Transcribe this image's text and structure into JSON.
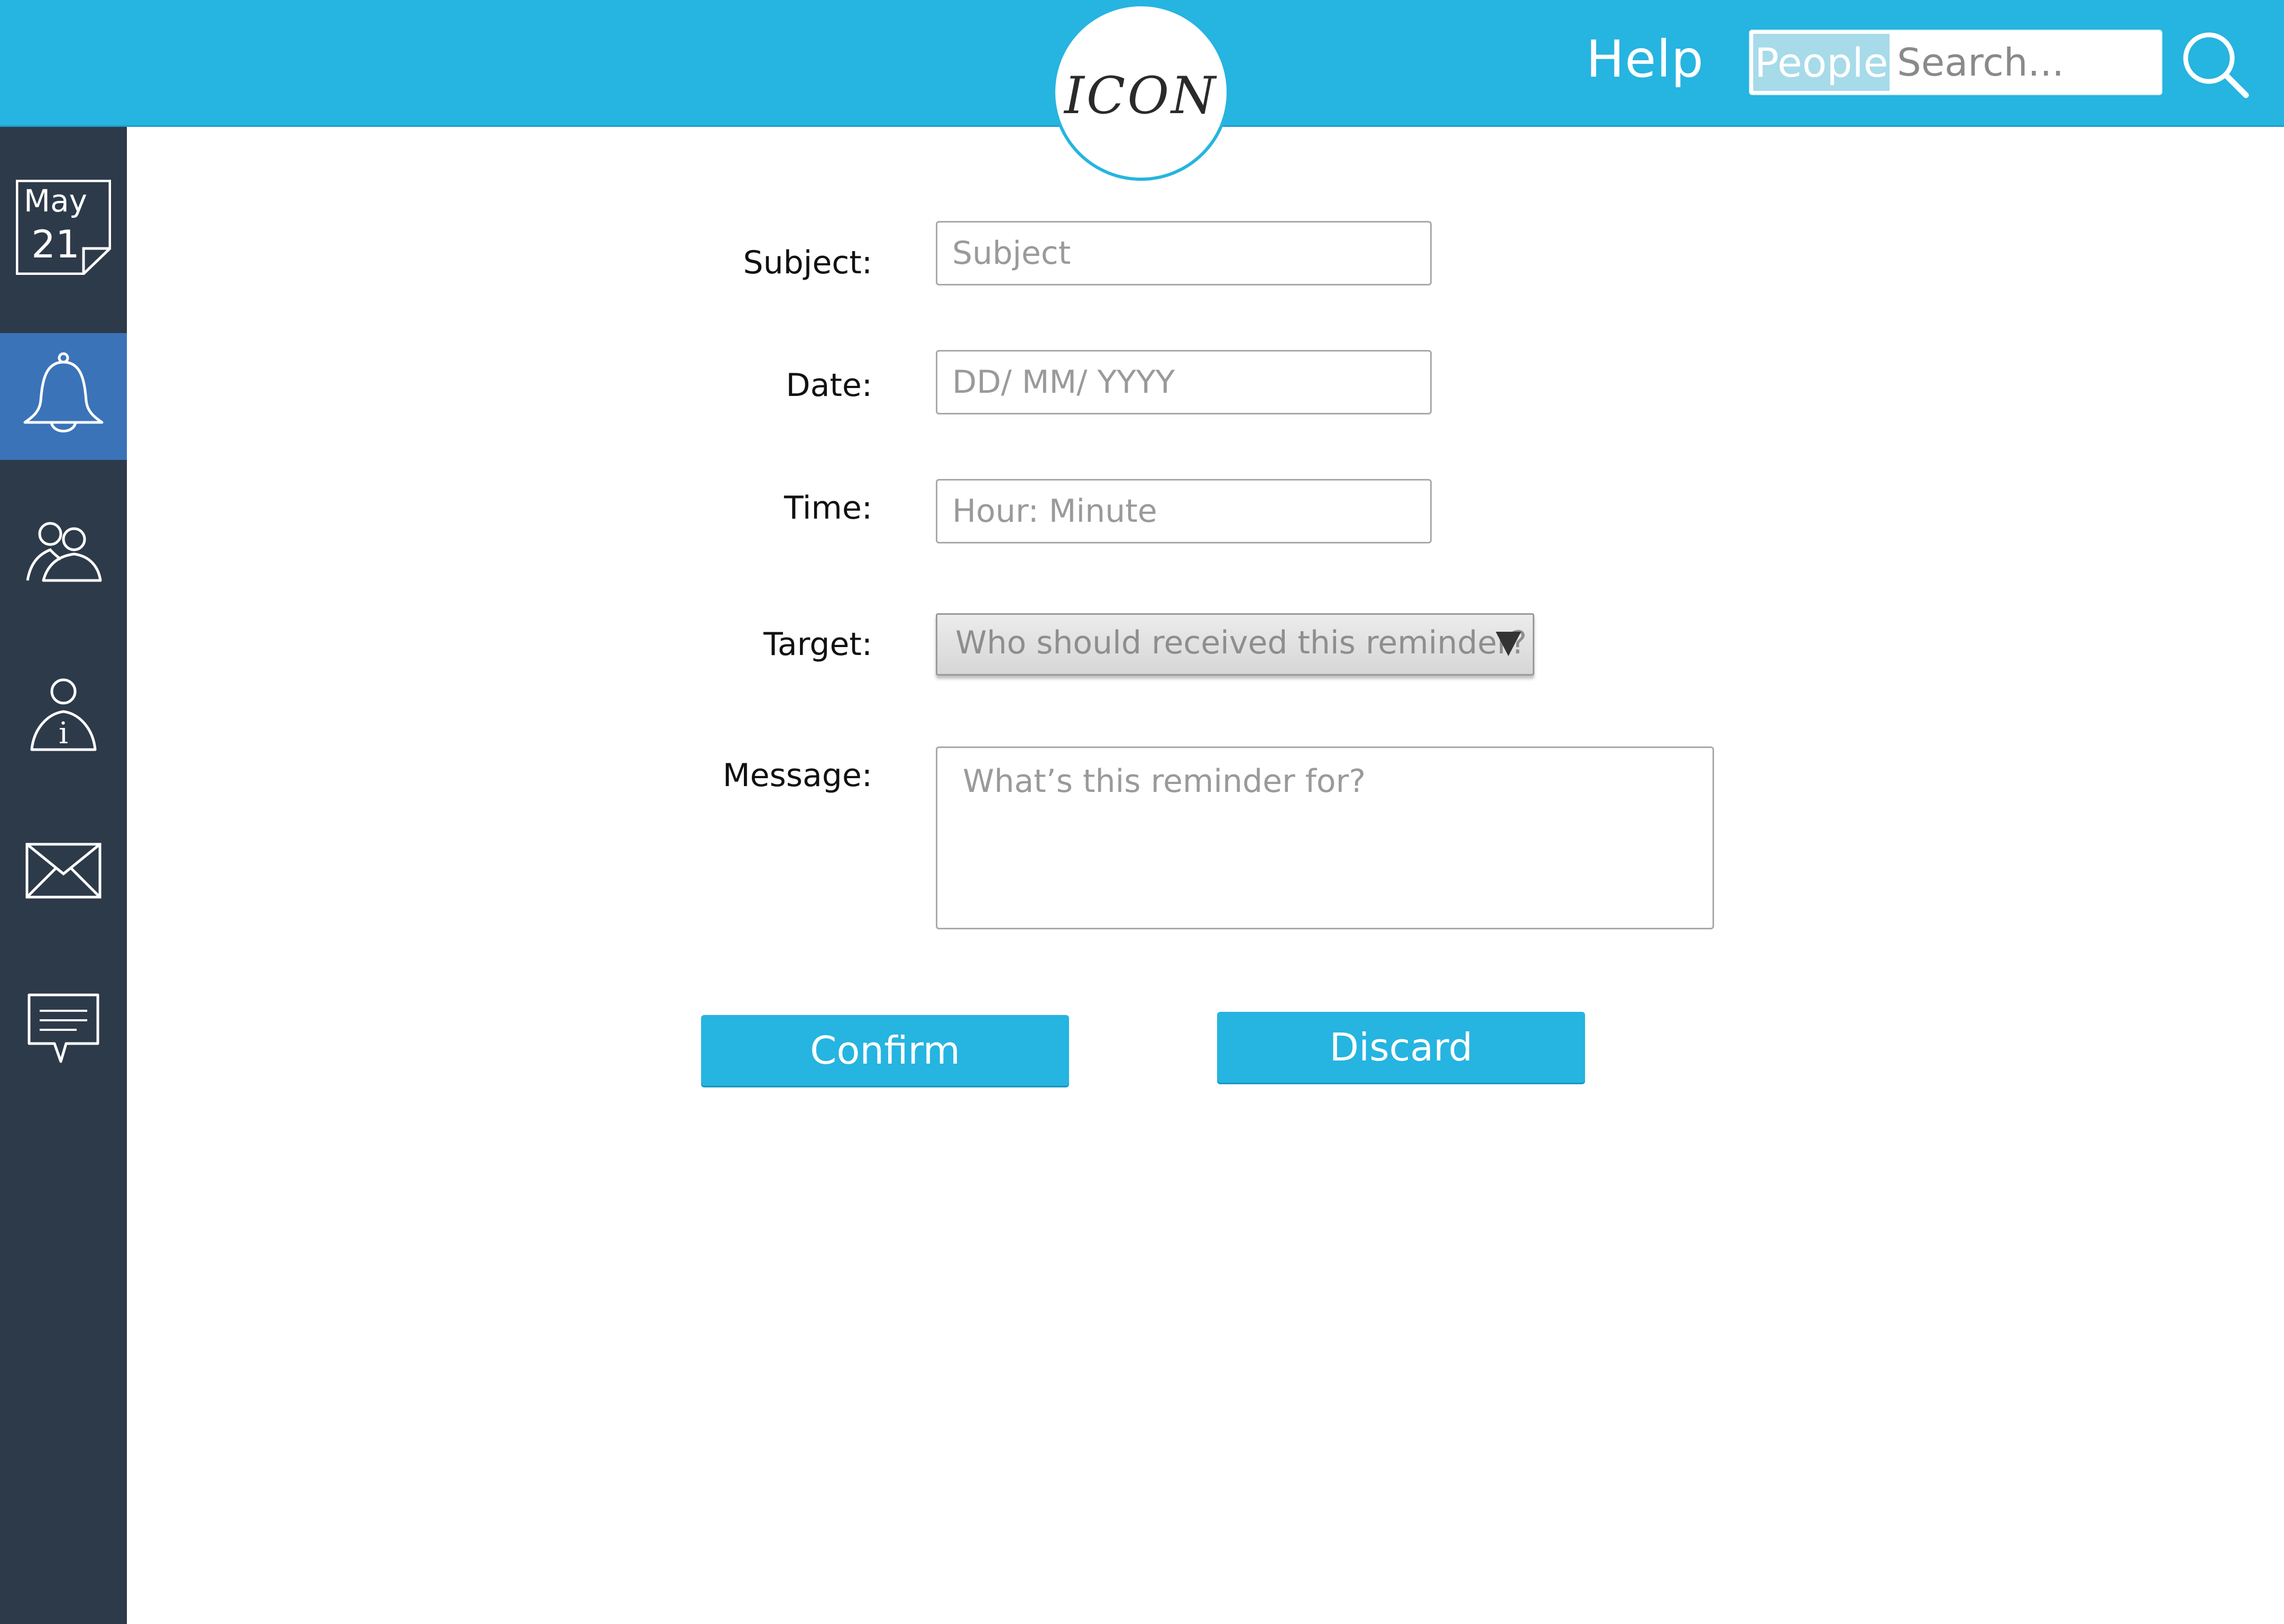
{
  "header": {
    "logo_text": "ICON",
    "help_label": "Help",
    "search": {
      "scope_label": "People",
      "placeholder": "Search..."
    }
  },
  "sidebar": {
    "calendar": {
      "month": "May",
      "day": "21"
    },
    "items": [
      {
        "icon": "calendar-icon"
      },
      {
        "icon": "bell-icon",
        "active": true
      },
      {
        "icon": "group-icon"
      },
      {
        "icon": "user-info-icon"
      },
      {
        "icon": "mail-icon"
      },
      {
        "icon": "chat-icon"
      }
    ]
  },
  "form": {
    "subject": {
      "label": "Subject:",
      "placeholder": "Subject"
    },
    "date": {
      "label": "Date:",
      "placeholder": "DD/ MM/ YYYY"
    },
    "time": {
      "label": "Time:",
      "placeholder": "Hour: Minute"
    },
    "target": {
      "label": "Target:",
      "selected": "Who should received this reminder?"
    },
    "message": {
      "label": "Message:",
      "placeholder": "What’s this reminder for?"
    }
  },
  "actions": {
    "confirm_label": "Confirm",
    "discard_label": "Discard"
  },
  "colors": {
    "accent": "#26b4e0",
    "sidebar_bg": "#2d3a4a",
    "sidebar_active": "#3b73b8"
  }
}
